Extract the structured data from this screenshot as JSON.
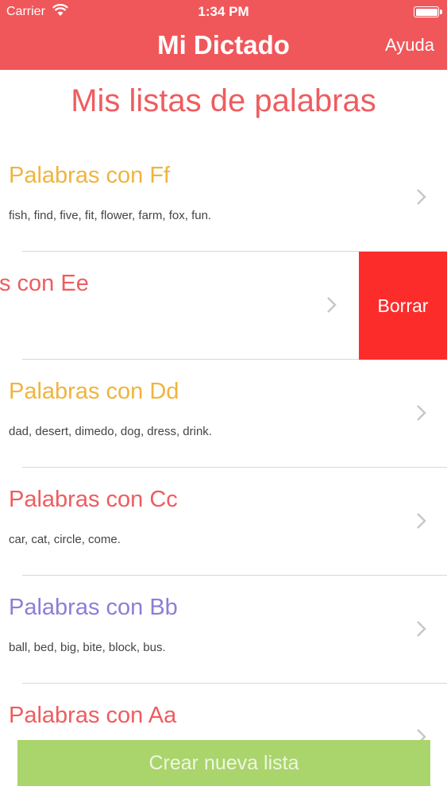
{
  "status_bar": {
    "carrier": "Carrier",
    "time": "1:34 PM"
  },
  "nav": {
    "title": "Mi Dictado",
    "help": "Ayuda"
  },
  "page": {
    "heading": "Mis listas de palabras"
  },
  "lists": [
    {
      "title": "Palabras con Ff",
      "words": "fish, find, five, fit, flower, farm, fox, fun.",
      "color": "#f0b43d"
    },
    {
      "title": "s con Ee",
      "words": "",
      "color": "#ef5c5f",
      "delete_label": "Borrar"
    },
    {
      "title": "Palabras con Dd",
      "words": "dad, desert, dimedo, dog, dress, drink.",
      "color": "#f0b43d"
    },
    {
      "title": "Palabras con Cc",
      "words": "car, cat, circle, come.",
      "color": "#ef5c5f"
    },
    {
      "title": "Palabras con Bb",
      "words": "ball, bed, big, bite, block, bus.",
      "color": "#8a7fd8"
    },
    {
      "title": "Palabras con Aa",
      "words": "",
      "color": "#ef5c5f"
    }
  ],
  "create_button": {
    "label": "Crear nueva lista"
  },
  "colors": {
    "header": "#f0575a",
    "delete": "#fc2c2b",
    "create": "#aad46c"
  }
}
